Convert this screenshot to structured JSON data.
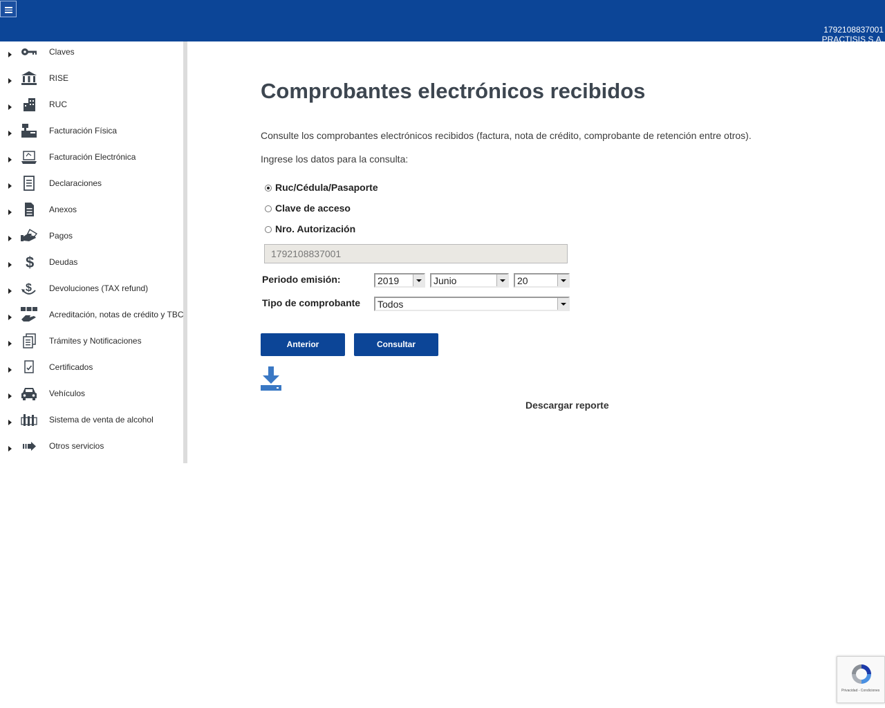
{
  "header": {
    "ruc": "1792108837001",
    "company": "PRACTISIS S.A."
  },
  "sidebar": {
    "items": [
      {
        "label": "Claves",
        "icon": "key-icon"
      },
      {
        "label": "RISE",
        "icon": "bank-icon"
      },
      {
        "label": "RUC",
        "icon": "buildings-icon"
      },
      {
        "label": "Facturación Física",
        "icon": "cash-register-icon"
      },
      {
        "label": "Facturación Electrónica",
        "icon": "laptop-icon"
      },
      {
        "label": "Declaraciones",
        "icon": "document-icon"
      },
      {
        "label": "Anexos",
        "icon": "file-icon"
      },
      {
        "label": "Pagos",
        "icon": "hand-payment-icon"
      },
      {
        "label": "Deudas",
        "icon": "dollar-icon"
      },
      {
        "label": "Devoluciones (TAX refund)",
        "icon": "refund-icon"
      },
      {
        "label": "Acreditación, notas de crédito y TBC",
        "icon": "credit-hand-icon"
      },
      {
        "label": "Trámites y Notificaciones",
        "icon": "notifications-icon"
      },
      {
        "label": "Certificados",
        "icon": "certificate-icon"
      },
      {
        "label": "Vehículos",
        "icon": "car-icon"
      },
      {
        "label": "Sistema de venta de alcohol",
        "icon": "alcohol-icon"
      },
      {
        "label": "Otros servicios",
        "icon": "arrow-right-icon"
      }
    ]
  },
  "main": {
    "title": "Comprobantes electrónicos recibidos",
    "description": "Consulte los comprobantes electrónicos recibidos (factura, nota de crédito, comprobante de retención entre otros).",
    "prompt": "Ingrese los datos para la consulta:",
    "radio_options": [
      {
        "label": "Ruc/Cédula/Pasaporte",
        "checked": true
      },
      {
        "label": "Clave de acceso",
        "checked": false
      },
      {
        "label": "Nro. Autorización",
        "checked": false
      }
    ],
    "id_value": "1792108837001",
    "period_label": "Periodo emisión:",
    "year": "2019",
    "month": "Junio",
    "day": "20",
    "type_label": "Tipo de comprobante",
    "type_value": "Todos",
    "back_button": "Anterior",
    "search_button": "Consultar",
    "download_label": "Descargar reporte"
  },
  "recaptcha": {
    "text": "Privacidad - Condiciones"
  },
  "colors": {
    "brand": "#0c4597",
    "title": "#3d4650",
    "download": "#3a78c4"
  }
}
